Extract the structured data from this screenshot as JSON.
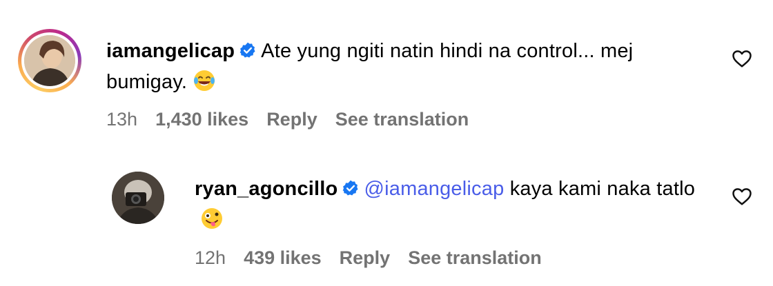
{
  "comments": [
    {
      "username": "iamangelicap",
      "verified": true,
      "text": "Ate yung ngiti natin hindi na control... mej bumigay.",
      "emoji": "laughing-tears-emoji",
      "time": "13h",
      "likes": "1,430 likes",
      "reply_label": "Reply",
      "translation_label": "See translation"
    },
    {
      "username": "ryan_agoncillo",
      "verified": true,
      "mention": "@iamangelicap",
      "text": "kaya kami naka tatlo",
      "emoji": "zany-face-emoji",
      "time": "12h",
      "likes": "439 likes",
      "reply_label": "Reply",
      "translation_label": "See translation"
    }
  ],
  "colors": {
    "mention": "#4a5de8",
    "meta_text": "#737373",
    "verified_badge": "#1877f2"
  }
}
